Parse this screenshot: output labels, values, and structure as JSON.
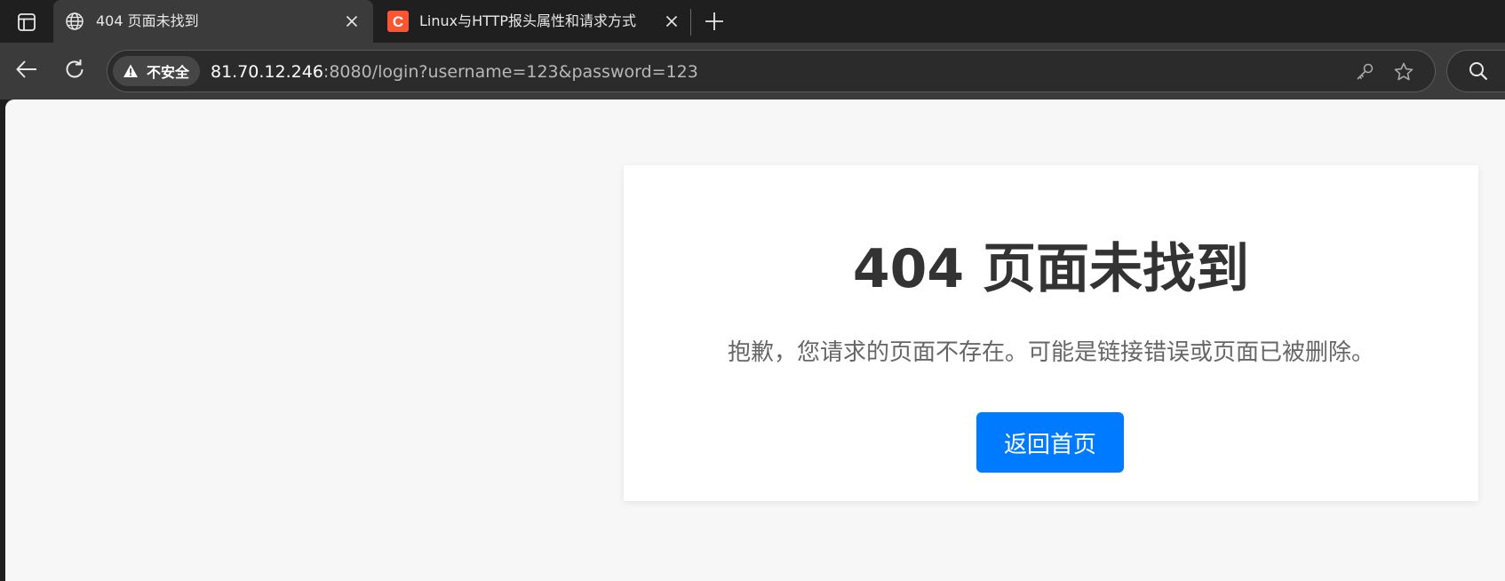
{
  "tabs": [
    {
      "title": "404 页面未找到",
      "favicon": "globe-icon",
      "active": true
    },
    {
      "title": "Linux与HTTP报头属性和请求方式",
      "favicon": "csdn-c-icon",
      "favicon_letter": "C",
      "favicon_color": "#fc5531",
      "active": false
    }
  ],
  "address_bar": {
    "security_label": "不安全",
    "url_host": "81.70.12.246",
    "url_rest": ":8080/login?username=123&password=123"
  },
  "page": {
    "title": "404 页面未找到",
    "message": "抱歉，您请求的页面不存在。可能是链接错误或页面已被删除。",
    "button_label": "返回首页"
  },
  "colors": {
    "accent": "#007bff",
    "tab_active_bg": "#3b3b3b",
    "page_bg": "#f7f7f7"
  }
}
